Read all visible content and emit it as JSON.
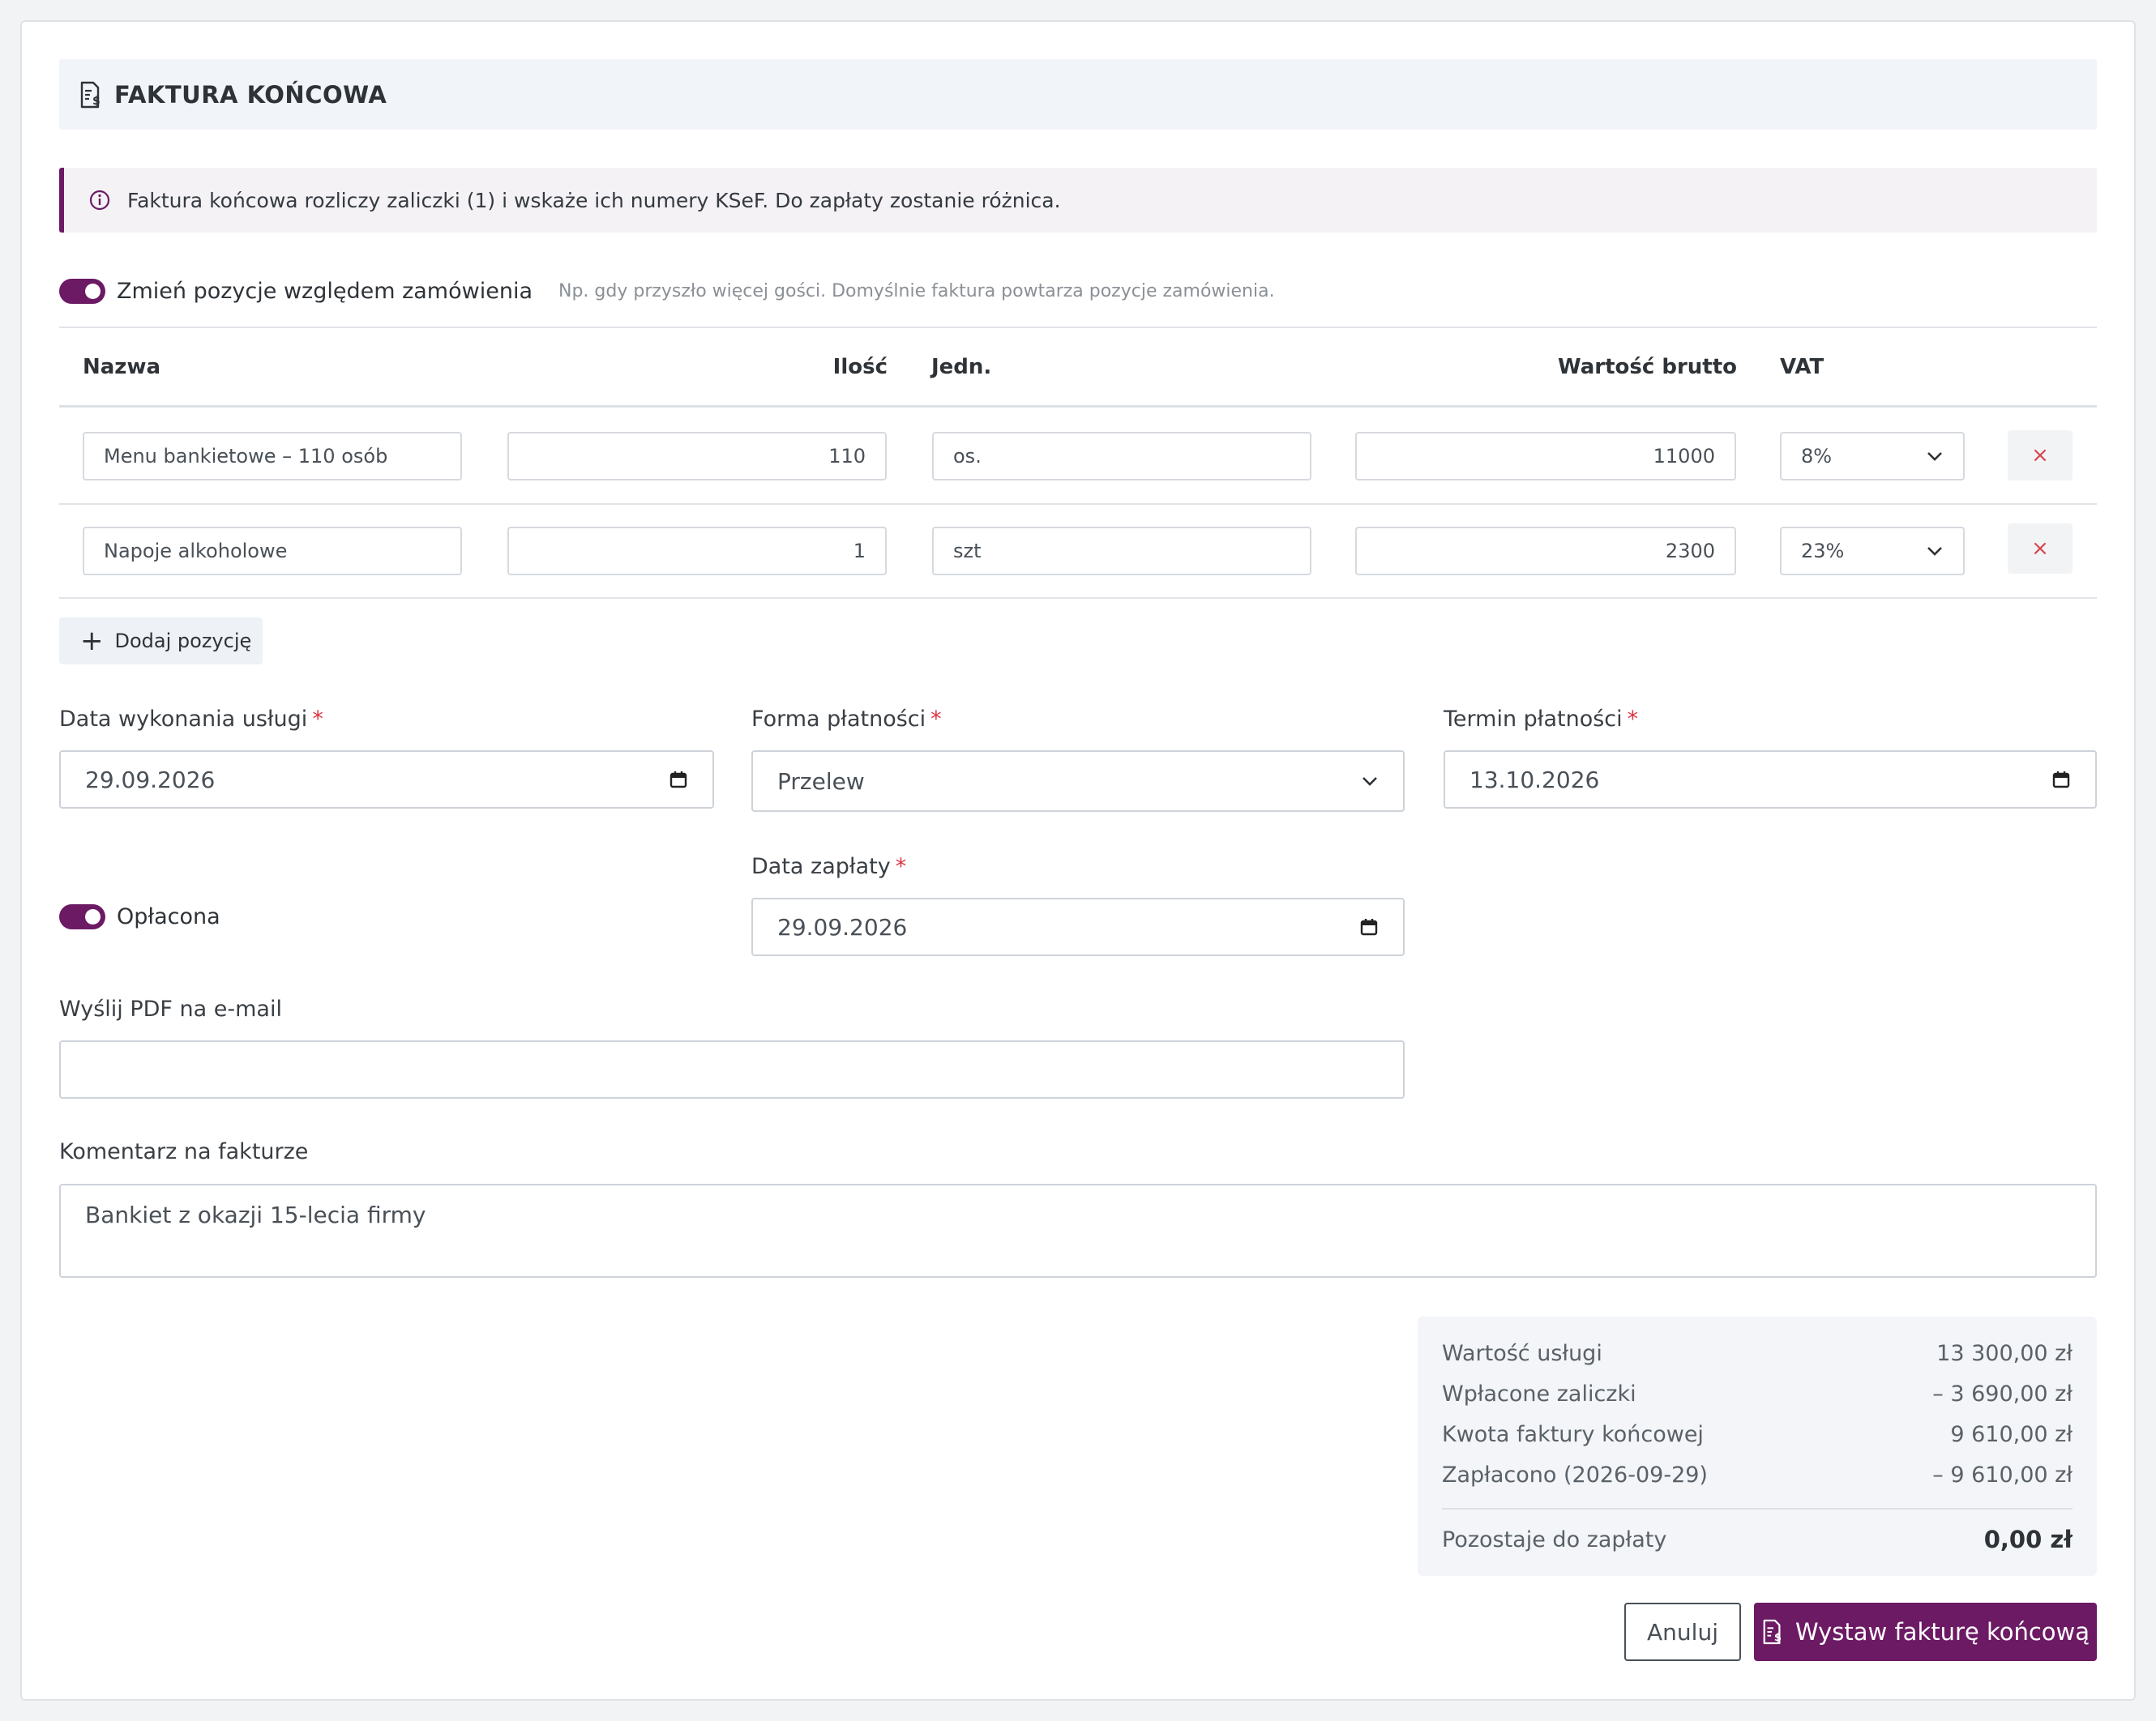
{
  "header": {
    "title": "FAKTURA KOŃCOWA",
    "icon": "invoice-icon"
  },
  "alert": {
    "text": "Faktura końcowa rozliczy zaliczki (1) i wskaże ich numery KSeF. Do zapłaty zostanie różnica.",
    "icon": "info-icon"
  },
  "modify_positions": {
    "label": "Zmień pozycje względem zamówienia",
    "help": "Np. gdy przyszło więcej gości. Domyślnie faktura powtarza pozycje zamówienia.",
    "enabled": true
  },
  "table": {
    "headers": {
      "name": "Nazwa",
      "qty": "Ilość",
      "unit": "Jedn.",
      "gross": "Wartość brutto",
      "vat": "VAT"
    },
    "rows": [
      {
        "name": "Menu bankietowe – 110 osób",
        "qty": "110",
        "unit": "os.",
        "gross": "11000",
        "vat": "8%",
        "delete": "×"
      },
      {
        "name": "Napoje alkoholowe",
        "qty": "1",
        "unit": "szt",
        "gross": "2300",
        "vat": "23%",
        "delete": "×"
      }
    ],
    "add_label": "Dodaj pozycję"
  },
  "form": {
    "service_date": {
      "label": "Data wykonania usługi",
      "value": "29.09.2026"
    },
    "payment_method": {
      "label": "Forma płatności",
      "value": "Przelew"
    },
    "payment_due": {
      "label": "Termin płatności",
      "value": "13.10.2026"
    },
    "paid": {
      "label": "Opłacona",
      "enabled": true
    },
    "payment_date": {
      "label": "Data zapłaty",
      "value": "29.09.2026"
    },
    "email": {
      "label": "Wyślij PDF na e-mail",
      "value": ""
    },
    "comment": {
      "label": "Komentarz na fakturze",
      "value": "Bankiet z okazji 15-lecia firmy"
    },
    "required_mark": "*"
  },
  "summary": {
    "rows": [
      {
        "label": "Wartość usługi",
        "value": "13 300,00 zł"
      },
      {
        "label": "Wpłacone zaliczki",
        "value": "– 3 690,00 zł"
      },
      {
        "label": "Kwota faktury końcowej",
        "value": "9 610,00 zł"
      },
      {
        "label": "Zapłacono (2026-09-29)",
        "value": "– 9 610,00 zł"
      }
    ],
    "total": {
      "label": "Pozostaje do zapłaty",
      "value": "0,00 zł"
    }
  },
  "actions": {
    "cancel": "Anuluj",
    "submit": "Wystaw fakturę końcową"
  },
  "colors": {
    "accent": "#6c1a64",
    "required": "#dc3545",
    "delete": "#d6454f"
  }
}
